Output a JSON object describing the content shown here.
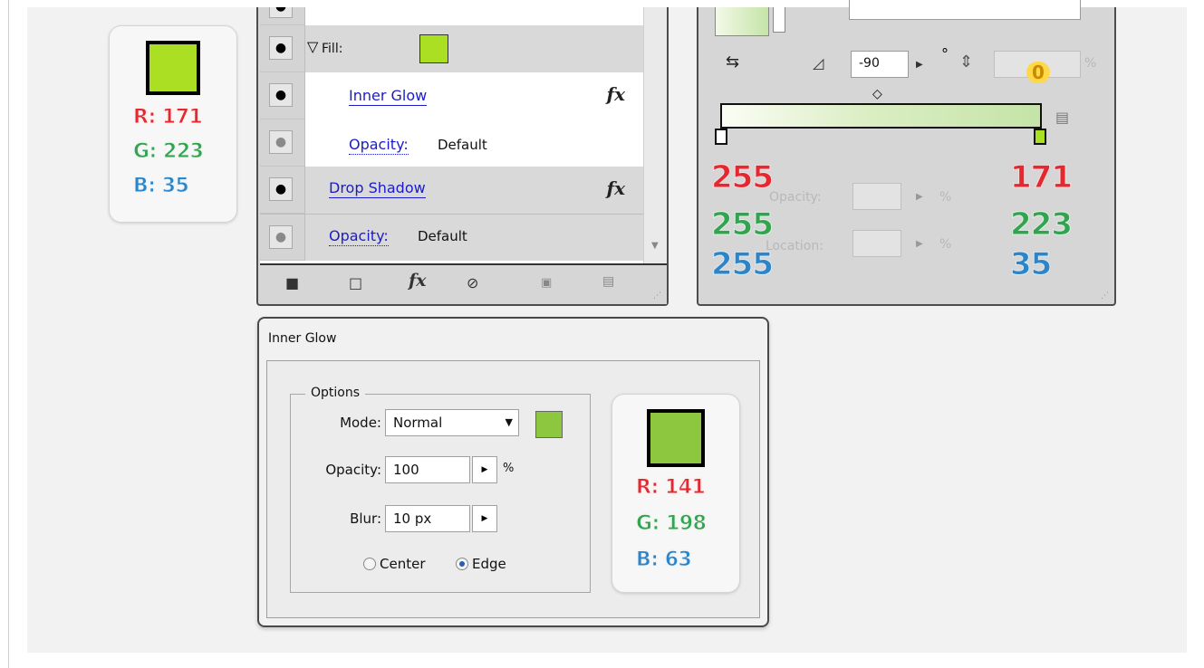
{
  "top_color_card": {
    "swatch_color": "#abdf23",
    "r_text": "R: 171",
    "g_text": "G: 223",
    "b_text": "B: 35"
  },
  "appearance_panel": {
    "rows": [
      {
        "label": "Fill:",
        "type": "fill",
        "swatch_color": "#abdf23"
      },
      {
        "label": "Inner Glow",
        "type": "effect",
        "fx": "fx"
      },
      {
        "label": "Opacity:",
        "value": "Default",
        "type": "opacity"
      },
      {
        "label": "Drop Shadow",
        "type": "effect",
        "fx": "fx"
      },
      {
        "label": "Opacity:",
        "value": "Default",
        "type": "opacity"
      }
    ],
    "toolbar_icons": [
      "square-icon",
      "new-square-icon",
      "fx-icon",
      "clear-icon",
      "duplicate-icon",
      "trash-icon"
    ],
    "fx_label": "fx"
  },
  "gradient_panel": {
    "angle_value": "-90",
    "angle_unit": "°",
    "aspect_value": "0",
    "percent_label": "%",
    "opacity_label": "Opacity:",
    "location_label": "Location:",
    "left_stop": {
      "r": "255",
      "g": "255",
      "b": "255"
    },
    "right_stop": {
      "r": "171",
      "g": "223",
      "b": "35"
    },
    "colors": {
      "left": "#ffffff",
      "right": "#abdf23"
    }
  },
  "inner_glow_dialog": {
    "title": "Inner Glow",
    "options_legend": "Options",
    "mode_label": "Mode:",
    "mode_value": "Normal",
    "mode_swatch_color": "#8dc63f",
    "opacity_label": "Opacity:",
    "opacity_value": "100",
    "opacity_unit": "%",
    "blur_label": "Blur:",
    "blur_value": "10 px",
    "radio_center": "Center",
    "radio_edge": "Edge",
    "selected_radio": "Edge"
  },
  "bottom_color_card": {
    "swatch_color": "#8dc63f",
    "r_text": "R: 141",
    "g_text": "G: 198",
    "b_text": "B: 63"
  }
}
